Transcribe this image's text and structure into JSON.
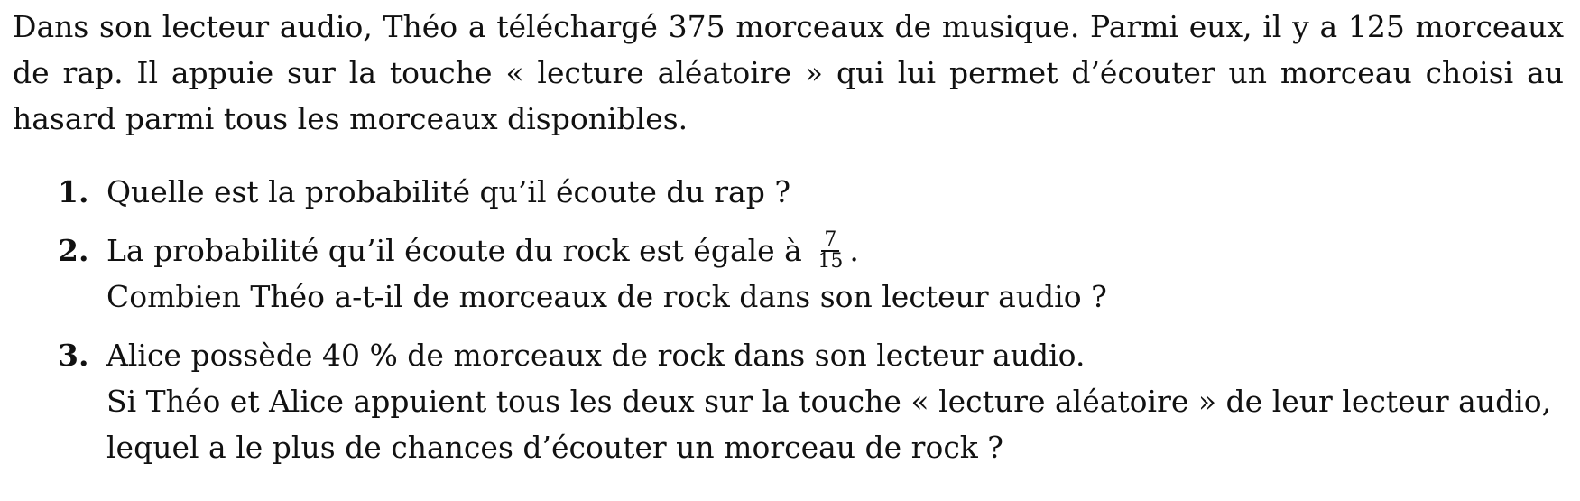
{
  "intro": {
    "text": "Dans son lecteur audio, Théo a téléchargé 375 morceaux de musique. Parmi eux, il y a 125 morceaux de rap. Il appuie sur la touche « lecture aléatoire » qui lui permet d’écouter un morceau choisi au hasard parmi tous les morceaux disponibles."
  },
  "questions": [
    {
      "number": "1.",
      "line1": "Quelle est la probabilité qu’il écoute du rap ?"
    },
    {
      "number": "2.",
      "line1_before": "La probabilité qu’il écoute du rock est égale à",
      "fraction_numerator": "7",
      "fraction_denominator": "15",
      "line1_after": ".",
      "line2": "Combien Théo a-t-il de morceaux de rock dans son lecteur audio ?"
    },
    {
      "number": "3.",
      "line1": "Alice possède 40 % de morceaux de rock dans son lecteur audio.",
      "line2": "Si Théo et Alice appuient tous les deux sur la touche « lecture aléatoire » de leur lecteur audio,",
      "line3": "lequel a le plus de chances d’écouter un morceau de rock ?"
    }
  ]
}
